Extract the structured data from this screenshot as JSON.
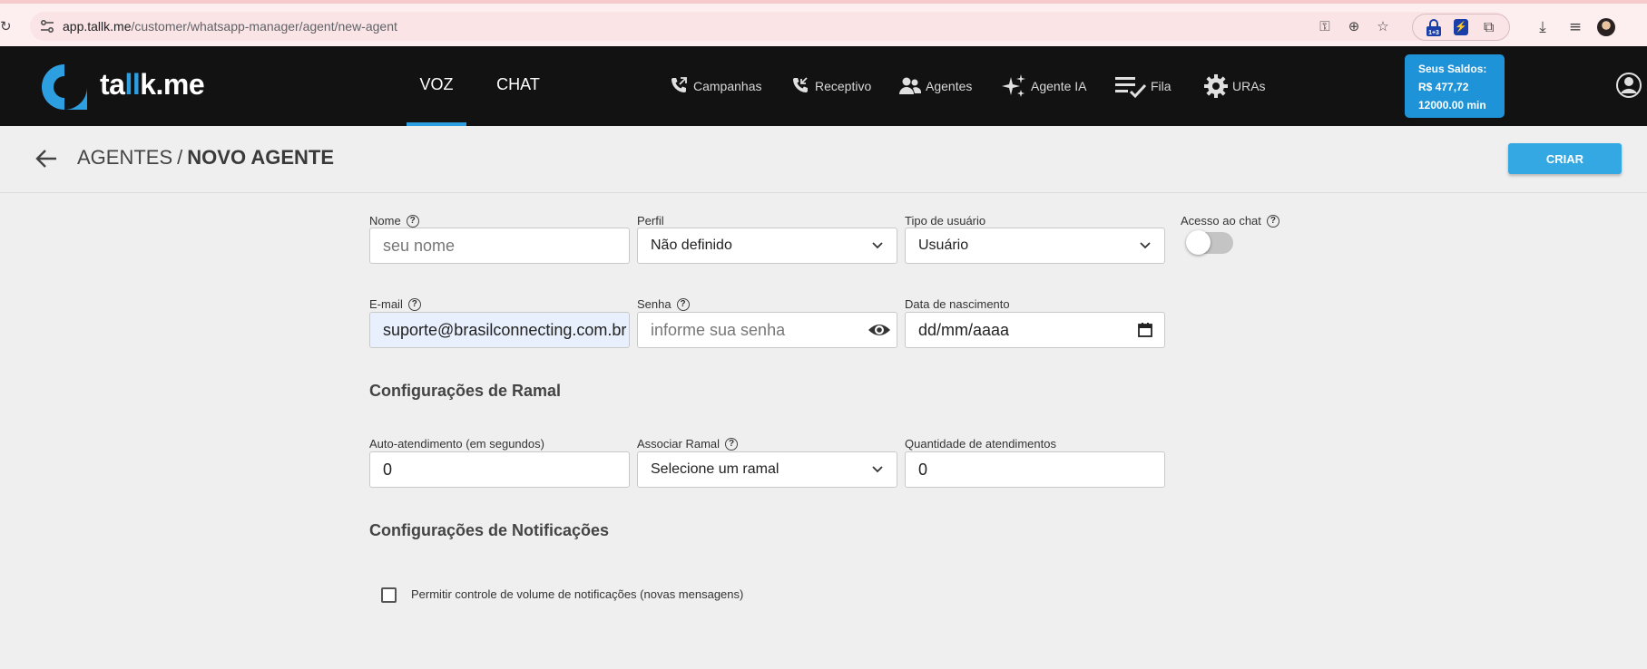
{
  "browser": {
    "url_domain": "app.tallk.me",
    "url_path": "/customer/whatsapp-manager/agent/new-agent",
    "extension_badge": "1+3"
  },
  "header": {
    "logo_part1": "ta",
    "logo_part2": "ll",
    "logo_part3": "k.me",
    "tabs": [
      {
        "label": "VOZ",
        "active": true
      },
      {
        "label": "CHAT",
        "active": false
      }
    ],
    "nav": [
      {
        "label": "Campanhas",
        "icon": "phone-outgoing-icon"
      },
      {
        "label": "Receptivo",
        "icon": "phone-incoming-icon"
      },
      {
        "label": "Agentes",
        "icon": "users-icon"
      },
      {
        "label": "Agente IA",
        "icon": "sparkles-icon"
      },
      {
        "label": "Fila",
        "icon": "checklist-icon"
      },
      {
        "label": "URAs",
        "icon": "gear-icon"
      }
    ],
    "balance": {
      "title": "Seus Saldos:",
      "money": "R$ 477,72",
      "minutes": "12000.00 min"
    }
  },
  "page": {
    "breadcrumb_parent": "AGENTES",
    "breadcrumb_separator": "/",
    "breadcrumb_current": "NOVO AGENTE",
    "create_button": "CRIAR"
  },
  "form": {
    "nome": {
      "label": "Nome",
      "placeholder": "seu nome"
    },
    "perfil": {
      "label": "Perfil",
      "value": "Não definido"
    },
    "tipo_usuario": {
      "label": "Tipo de usuário",
      "value": "Usuário"
    },
    "acesso_chat": {
      "label": "Acesso ao chat",
      "enabled": false
    },
    "email": {
      "label": "E-mail",
      "value": "suporte@brasilconnecting.com.br"
    },
    "senha": {
      "label": "Senha",
      "placeholder": "informe sua senha"
    },
    "data_nascimento": {
      "label": "Data de nascimento",
      "placeholder": "dd/mm/aaaa"
    },
    "ramal_section": "Configurações de Ramal",
    "auto_atendimento": {
      "label": "Auto-atendimento (em segundos)",
      "value": "0"
    },
    "associar_ramal": {
      "label": "Associar Ramal",
      "value": "Selecione um ramal"
    },
    "quantidade": {
      "label": "Quantidade de atendimentos",
      "value": "0"
    },
    "notif_section": "Configurações de Notificações",
    "notif_volume": {
      "label": "Permitir controle de volume de notificações (novas mensagens)",
      "checked": false
    }
  },
  "colors": {
    "accent": "#2d9fe0",
    "header_bg": "#121212",
    "page_bg": "#efefef"
  }
}
